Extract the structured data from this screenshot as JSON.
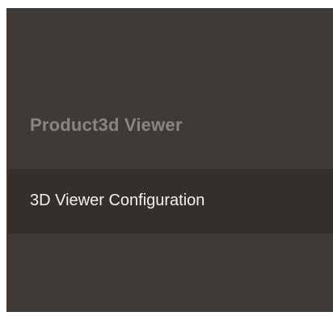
{
  "sidebar": {
    "section_title": "Product3d Viewer",
    "items": [
      {
        "label": "3D Viewer Configuration"
      }
    ]
  },
  "colors": {
    "panel_bg": "#403a37",
    "active_item_bg": "#352f2b",
    "section_title": "#8b8582",
    "item_text": "#f2f1ef"
  }
}
